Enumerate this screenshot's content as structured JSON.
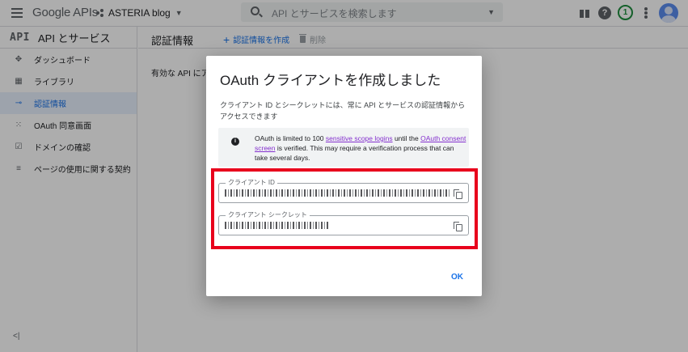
{
  "topbar": {
    "logo_google": "Google",
    "logo_apis": "APIs",
    "project_name": "ASTERIA blog",
    "search_placeholder": "API とサービスを検索します",
    "notification_count": "1",
    "help_glyph": "?"
  },
  "sidenav": {
    "header_logo": "API",
    "header_title": "API とサービス",
    "items": [
      {
        "label": "ダッシュボード",
        "icon": "dashboard-icon"
      },
      {
        "label": "ライブラリ",
        "icon": "library-icon"
      },
      {
        "label": "認証情報",
        "icon": "key-icon",
        "active": true
      },
      {
        "label": "OAuth 同意画面",
        "icon": "consent-icon"
      },
      {
        "label": "ドメインの確認",
        "icon": "domain-icon"
      },
      {
        "label": "ページの使用に関する契約",
        "icon": "settings-list-icon"
      }
    ],
    "collapse_glyph": "<|"
  },
  "main": {
    "page_title": "認証情報",
    "create_label": "認証情報を作成",
    "delete_label": "削除",
    "body_text": "有効な API にアク"
  },
  "dialog": {
    "title": "OAuth クライアントを作成しました",
    "description": "クライアント ID とシークレットには、常に API とサービスの認証情報からアクセスできます",
    "info": {
      "part1": "OAuth is limited to 100 ",
      "link1": "sensitive scope logins",
      "part2": " until the ",
      "link2": "OAuth consent screen",
      "part3": " is verified. This may require a verification process that can take several days."
    },
    "client_id_label": "クライアント ID",
    "client_id_value": "",
    "client_secret_label": "クライアント シークレット",
    "client_secret_value": "",
    "ok_label": "OK"
  },
  "colors": {
    "accent": "#1a73e8",
    "highlight_border": "#e8001c",
    "link": "#8430ce",
    "active_nav_bg": "#e8f0fe"
  }
}
